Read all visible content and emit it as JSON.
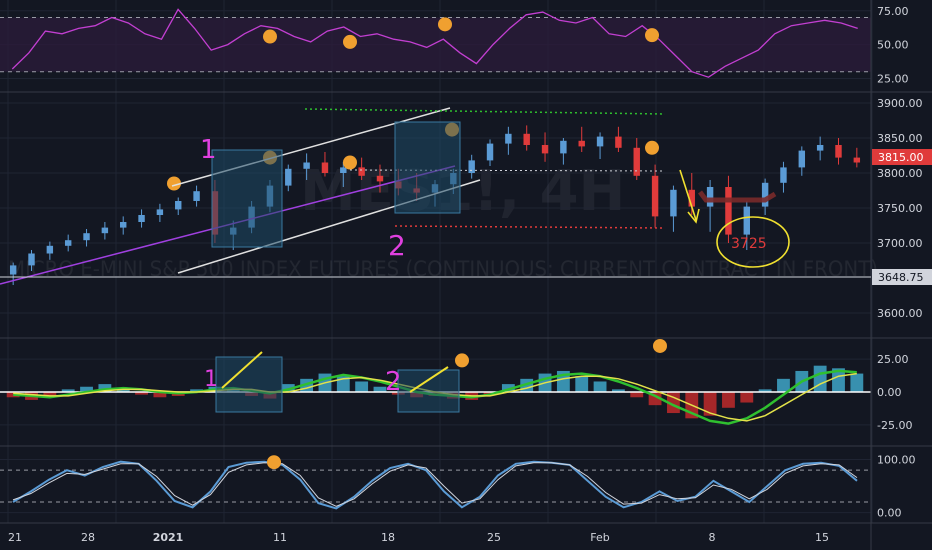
{
  "colors": {
    "background": "#131722",
    "grid": "#1f2433",
    "separator": "#363a45",
    "axis_text": "#d1d4dc",
    "rsi_line": "#c23fd1",
    "rsi_band": "#2a1c3a",
    "candle_up": "#5b9bd5",
    "candle_down": "#e03b3b",
    "candle_neutral": "#e6e6e6",
    "price_badge": "#e03b3b",
    "macd_fast": "#2fbf2f",
    "macd_slow": "#e2e24a",
    "stoch_line": "#5b9bd5",
    "annotation_orange": "#f0a030",
    "annotation_magenta": "#e040e0",
    "annotation_yellow": "#f0e030",
    "channel_line": "#e0e0e0",
    "trend_line": "#a040e0",
    "box_fill": "#1e4a66"
  },
  "watermark": {
    "symbol": "MES1!, 4H",
    "description": "MICRO E-MINI S&P 500 INDEX FUTURES (CONTINUOUS: CURRENT CONTRACT IN FRONT)"
  },
  "price_badges": {
    "current": "3815.00",
    "level": "3648.75"
  },
  "annotations": {
    "label_1": "1",
    "label_2": "2",
    "target": "3725"
  },
  "chart_data": [
    {
      "type": "line",
      "title": "",
      "pane": "rsi",
      "y_ticks": [
        "75.00",
        "50.00",
        "25.00"
      ],
      "ylim": [
        18,
        80
      ],
      "bands": [
        30,
        70
      ],
      "series": [
        {
          "values": [
            32,
            44,
            60,
            58,
            62,
            64,
            70,
            66,
            58,
            54,
            76,
            62,
            46,
            50,
            58,
            64,
            62,
            56,
            52,
            60,
            63,
            56,
            58,
            54,
            52,
            48,
            54,
            44,
            36,
            50,
            62,
            72,
            74,
            68,
            66,
            70,
            58,
            56,
            64,
            54,
            42,
            30,
            26,
            34,
            40,
            46,
            58,
            64,
            66,
            68,
            66,
            62
          ]
        }
      ],
      "markers": [
        56,
        52,
        65,
        57
      ]
    },
    {
      "type": "candlestick",
      "title": "",
      "pane": "price",
      "y_ticks": [
        "3900.00",
        "3850.00",
        "3800.00",
        "3750.00",
        "3700.00",
        "3600.00"
      ],
      "ylim": [
        3570,
        3910
      ],
      "x_ticks": [
        "21",
        "28",
        "2021",
        "11",
        "18",
        "25",
        "Feb",
        "8",
        "15"
      ],
      "ohlc": [
        [
          3655,
          3672,
          3640,
          3668
        ],
        [
          3668,
          3690,
          3660,
          3685
        ],
        [
          3685,
          3702,
          3676,
          3696
        ],
        [
          3696,
          3712,
          3688,
          3704
        ],
        [
          3704,
          3720,
          3695,
          3714
        ],
        [
          3714,
          3730,
          3705,
          3722
        ],
        [
          3722,
          3738,
          3712,
          3730
        ],
        [
          3730,
          3748,
          3722,
          3740
        ],
        [
          3740,
          3756,
          3730,
          3748
        ],
        [
          3748,
          3765,
          3740,
          3760
        ],
        [
          3760,
          3782,
          3752,
          3774
        ],
        [
          3774,
          3790,
          3700,
          3712
        ],
        [
          3712,
          3732,
          3690,
          3722
        ],
        [
          3722,
          3760,
          3714,
          3752
        ],
        [
          3752,
          3790,
          3744,
          3782
        ],
        [
          3782,
          3812,
          3774,
          3806
        ],
        [
          3806,
          3828,
          3790,
          3815
        ],
        [
          3815,
          3830,
          3795,
          3800
        ],
        [
          3800,
          3816,
          3780,
          3808
        ],
        [
          3808,
          3822,
          3790,
          3796
        ],
        [
          3796,
          3812,
          3772,
          3788
        ],
        [
          3788,
          3806,
          3768,
          3778
        ],
        [
          3778,
          3800,
          3760,
          3772
        ],
        [
          3772,
          3790,
          3752,
          3784
        ],
        [
          3784,
          3806,
          3770,
          3800
        ],
        [
          3800,
          3826,
          3792,
          3818
        ],
        [
          3818,
          3848,
          3810,
          3842
        ],
        [
          3842,
          3866,
          3826,
          3856
        ],
        [
          3856,
          3868,
          3832,
          3840
        ],
        [
          3840,
          3858,
          3816,
          3828
        ],
        [
          3828,
          3850,
          3812,
          3846
        ],
        [
          3846,
          3866,
          3830,
          3838
        ],
        [
          3838,
          3858,
          3820,
          3852
        ],
        [
          3852,
          3866,
          3830,
          3836
        ],
        [
          3836,
          3850,
          3790,
          3796
        ],
        [
          3796,
          3812,
          3722,
          3738
        ],
        [
          3738,
          3782,
          3716,
          3776
        ],
        [
          3776,
          3800,
          3740,
          3752
        ],
        [
          3752,
          3790,
          3716,
          3780
        ],
        [
          3780,
          3796,
          3700,
          3712
        ],
        [
          3712,
          3760,
          3690,
          3752
        ],
        [
          3752,
          3792,
          3740,
          3786
        ],
        [
          3786,
          3816,
          3772,
          3808
        ],
        [
          3808,
          3838,
          3796,
          3832
        ],
        [
          3832,
          3852,
          3818,
          3840
        ],
        [
          3840,
          3850,
          3812,
          3822
        ],
        [
          3822,
          3836,
          3808,
          3815
        ]
      ]
    },
    {
      "type": "histogram",
      "title": "",
      "pane": "macd",
      "y_ticks": [
        "25.00",
        "0.00",
        "-25.00"
      ],
      "ylim": [
        -38,
        38
      ],
      "histogram": [
        -4,
        -6,
        -3,
        2,
        4,
        6,
        3,
        -2,
        -4,
        -3,
        2,
        4,
        3,
        -3,
        -5,
        6,
        10,
        14,
        12,
        8,
        4,
        -2,
        -4,
        -3,
        -5,
        -6,
        -2,
        6,
        10,
        14,
        16,
        12,
        8,
        2,
        -4,
        -10,
        -16,
        -20,
        -18,
        -12,
        -8,
        2,
        10,
        16,
        20,
        18,
        14
      ],
      "series": [
        {
          "values": [
            -2,
            -3,
            -4,
            -2,
            0,
            2,
            3,
            2,
            0,
            -1,
            0,
            2,
            3,
            1,
            -1,
            2,
            6,
            10,
            13,
            11,
            8,
            4,
            0,
            -2,
            -3,
            -4,
            -2,
            2,
            6,
            10,
            13,
            14,
            12,
            8,
            3,
            -3,
            -10,
            -16,
            -22,
            -24,
            -20,
            -12,
            -2,
            8,
            14,
            16,
            15
          ]
        },
        {
          "values": [
            -1,
            -2,
            -3,
            -3,
            -1,
            1,
            2,
            2,
            1,
            0,
            0,
            1,
            2,
            2,
            0,
            0,
            3,
            7,
            10,
            11,
            9,
            6,
            3,
            0,
            -2,
            -3,
            -3,
            0,
            3,
            7,
            10,
            12,
            12,
            10,
            6,
            1,
            -4,
            -10,
            -16,
            -20,
            -22,
            -18,
            -10,
            -2,
            6,
            12,
            14
          ]
        }
      ],
      "markers": [
        24,
        35
      ]
    },
    {
      "type": "line",
      "title": "",
      "pane": "stochastic",
      "y_ticks": [
        "100.00",
        "0.00"
      ],
      "ylim": [
        -12,
        118
      ],
      "bands": [
        20,
        80
      ],
      "series": [
        {
          "values": [
            20,
            40,
            62,
            80,
            70,
            86,
            96,
            92,
            60,
            22,
            10,
            40,
            86,
            94,
            96,
            90,
            62,
            18,
            8,
            30,
            60,
            84,
            92,
            80,
            40,
            10,
            30,
            70,
            92,
            96,
            94,
            90,
            60,
            30,
            10,
            20,
            40,
            22,
            30,
            60,
            40,
            20,
            50,
            80,
            92,
            94,
            88,
            60
          ]
        },
        {
          "values": [
            24,
            36,
            56,
            74,
            72,
            82,
            92,
            92,
            68,
            32,
            14,
            34,
            76,
            90,
            94,
            92,
            70,
            28,
            12,
            26,
            54,
            78,
            90,
            84,
            50,
            18,
            26,
            62,
            88,
            94,
            94,
            90,
            68,
            38,
            16,
            18,
            34,
            26,
            28,
            52,
            44,
            26,
            44,
            74,
            88,
            92,
            90,
            66
          ]
        }
      ],
      "markers": [
        95
      ]
    }
  ]
}
